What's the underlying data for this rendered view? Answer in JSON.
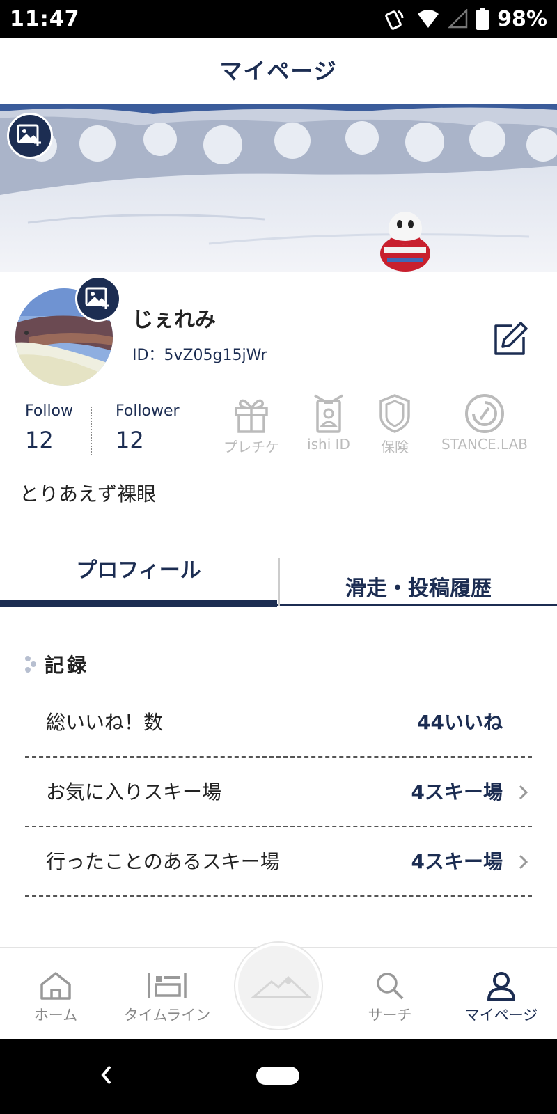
{
  "status_bar": {
    "time": "11:47",
    "battery": "98%"
  },
  "header": {
    "title": "マイページ"
  },
  "profile": {
    "name": "じぇれみ",
    "id_text": "ID：5vZ05g15jWr",
    "follow_label": "Follow",
    "follow_count": "12",
    "follower_label": "Follower",
    "follower_count": "12",
    "features": [
      {
        "label": "プレチケ",
        "icon": "gift-icon"
      },
      {
        "label": "ishi ID",
        "icon": "id-card-icon"
      },
      {
        "label": "保険",
        "icon": "shield-icon"
      },
      {
        "label": "STANCE.LAB",
        "icon": "stance-lab-icon"
      }
    ],
    "bio": "とりあえず裸眼"
  },
  "tabs": [
    {
      "label": "プロフィール",
      "active": true
    },
    {
      "label": "滑走・投稿履歴",
      "active": false
    }
  ],
  "records": {
    "title": "記録",
    "rows": [
      {
        "label": "総いいね！数",
        "value": "44いいね",
        "chevron": false
      },
      {
        "label": "お気に入りスキー場",
        "value": "4スキー場",
        "chevron": true
      },
      {
        "label": "行ったことのあるスキー場",
        "value": "4スキー場",
        "chevron": true
      }
    ]
  },
  "bottom_nav": [
    {
      "label": "ホーム",
      "icon": "home-icon",
      "active": false
    },
    {
      "label": "タイムライン",
      "icon": "timeline-icon",
      "active": false
    },
    {
      "label": "",
      "icon": "mountain-icon",
      "active": false
    },
    {
      "label": "サーチ",
      "icon": "search-icon",
      "active": false
    },
    {
      "label": "マイページ",
      "icon": "person-icon",
      "active": true
    }
  ],
  "colors": {
    "primary": "#1c2d52",
    "inactive": "#888888",
    "disabled": "#bbbbbb"
  }
}
